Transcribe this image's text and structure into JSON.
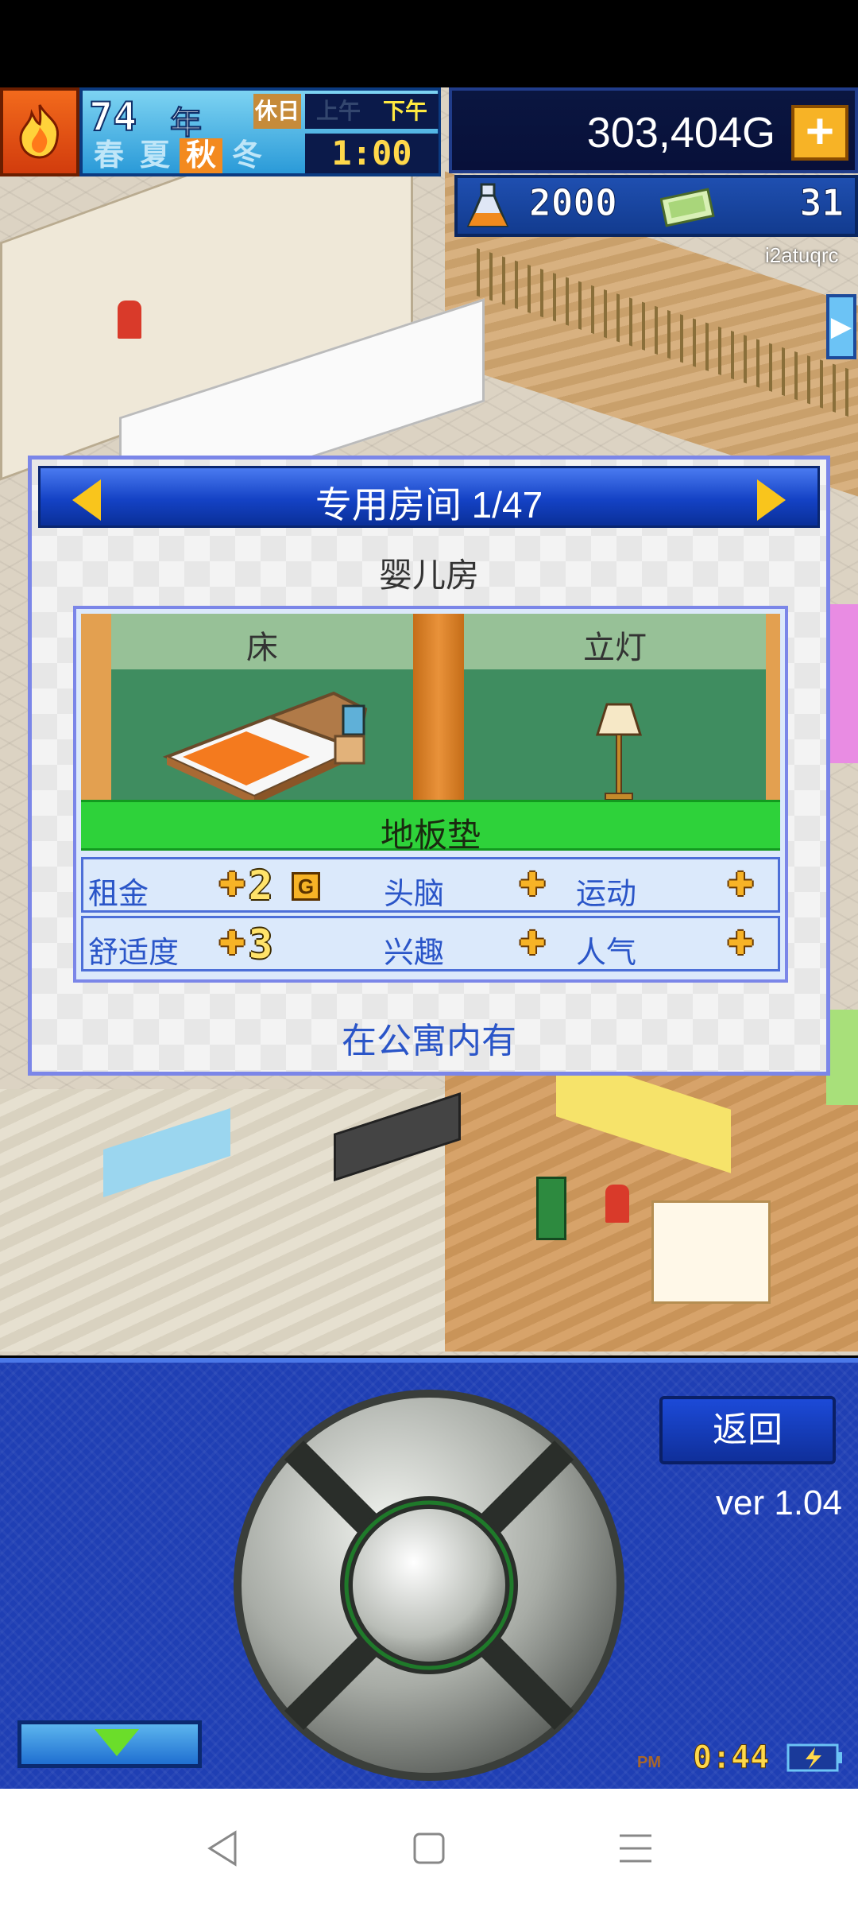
{
  "hud": {
    "year": "74",
    "year_unit": "年",
    "seasons": [
      "春",
      "夏",
      "秋",
      "冬"
    ],
    "active_season": "秋",
    "day_off": "休日",
    "am": "上午",
    "pm": "下午",
    "time": "1:00",
    "money": "303,404G",
    "money_add": "+",
    "research_points": "2000",
    "tickets": "31",
    "username": "i2atuqrc"
  },
  "dialog": {
    "title": "专用房间 1/47",
    "room_name": "婴儿房",
    "items": [
      "床",
      "立灯"
    ],
    "floor": "地板垫",
    "stats_row1": {
      "rent_label": "租金",
      "rent_value": "2",
      "rent_unit": "G",
      "brain_label": "头脑",
      "sports_label": "运动"
    },
    "stats_row2": {
      "comfort_label": "舒适度",
      "comfort_value": "3",
      "hobby_label": "兴趣",
      "popularity_label": "人气"
    },
    "availability": "在公寓内有"
  },
  "controller": {
    "back_label": "返回",
    "version": "ver 1.04",
    "pm_label": "PM",
    "clock": "0:44"
  },
  "icons": {
    "fire": "fire-icon",
    "flask": "flask-icon",
    "ticket": "ticket-icon",
    "battery": "battery-icon"
  },
  "colors": {
    "dialog_header": "#1442c5",
    "floor_bar": "#2ed23a",
    "accent_gold": "#f7b326",
    "stat_text": "#2a55c8"
  }
}
